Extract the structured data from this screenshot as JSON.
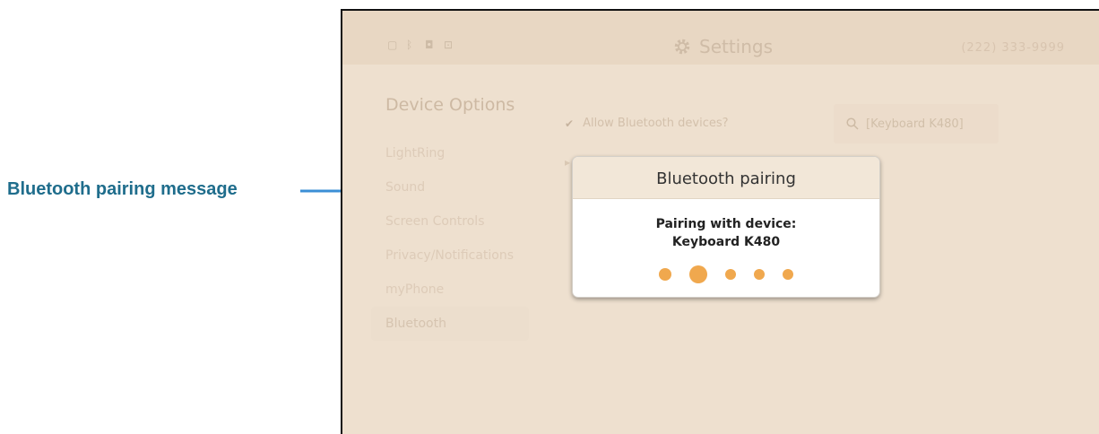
{
  "callout": {
    "label": "Bluetooth pairing message"
  },
  "header": {
    "title": "Settings",
    "phone": "(222) 333-9999"
  },
  "status_icons": [
    "screen-icon",
    "bluetooth-icon",
    "camera-icon",
    "lock-icon"
  ],
  "sidebar": {
    "heading": "Device Options",
    "items": [
      {
        "label": "LightRing"
      },
      {
        "label": "Sound"
      },
      {
        "label": "Screen Controls"
      },
      {
        "label": "Privacy/Notifications"
      },
      {
        "label": "myPhone"
      },
      {
        "label": "Bluetooth",
        "active": true
      }
    ]
  },
  "options": {
    "allow_bluetooth": "Allow Bluetooth devices?"
  },
  "search": {
    "value": "[Keyboard K480]"
  },
  "dialog": {
    "title": "Bluetooth pairing",
    "line1": "Pairing with device:",
    "line2": "Keyboard K480",
    "progress_dots": 5,
    "progress_color": "#f0a84e"
  },
  "colors": {
    "callout": "#1f6d8c",
    "arrow": "#3b8fd6",
    "background": "#eee0cf"
  }
}
